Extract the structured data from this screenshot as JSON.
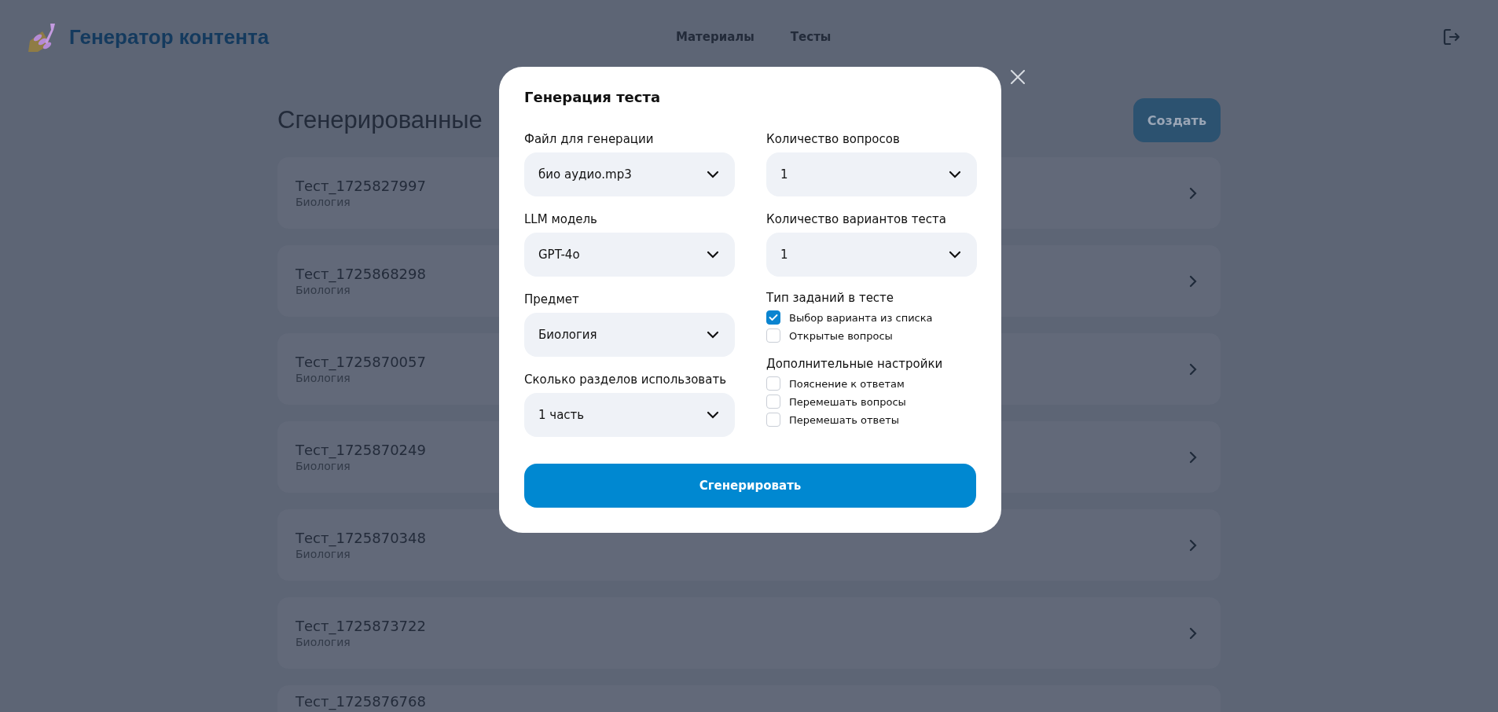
{
  "header": {
    "logo_text": "Генератор контента",
    "nav": [
      {
        "label": "Материалы"
      },
      {
        "label": "Тесты"
      }
    ]
  },
  "page": {
    "title": "Сгенерированные",
    "create_button": "Создать",
    "tests": [
      {
        "name": "Тест_1725827997",
        "subject": "Биология"
      },
      {
        "name": "Тест_1725868298",
        "subject": "Биология"
      },
      {
        "name": "Тест_1725870057",
        "subject": "Биология"
      },
      {
        "name": "Тест_1725870249",
        "subject": "Биология"
      },
      {
        "name": "Тест_1725870348",
        "subject": "Биология"
      },
      {
        "name": "Тест_1725873722",
        "subject": "Биология"
      },
      {
        "name": "Тест_1725876768"
      }
    ]
  },
  "modal": {
    "title": "Генерация теста",
    "left_fields": [
      {
        "label": "Файл для генерации",
        "value": "био аудио.mp3"
      },
      {
        "label": "LLM модель",
        "value": "GPT-4o"
      },
      {
        "label": "Предмет",
        "value": "Биология"
      },
      {
        "label": "Сколько разделов использовать",
        "value": "1 часть"
      }
    ],
    "right_fields": [
      {
        "label": "Количество вопросов",
        "value": "1"
      },
      {
        "label": "Количество вариантов теста",
        "value": "1"
      }
    ],
    "groups": [
      {
        "title": "Тип заданий в тесте",
        "options": [
          {
            "label": "Выбор варианта из списка",
            "checked": true
          },
          {
            "label": "Открытые вопросы",
            "checked": false
          }
        ]
      },
      {
        "title": "Дополнительные настройки",
        "options": [
          {
            "label": "Пояснение к ответам",
            "checked": false
          },
          {
            "label": "Перемешать вопросы",
            "checked": false
          },
          {
            "label": "Перемешать ответы",
            "checked": false
          }
        ]
      }
    ],
    "submit": "Сгенерировать"
  }
}
